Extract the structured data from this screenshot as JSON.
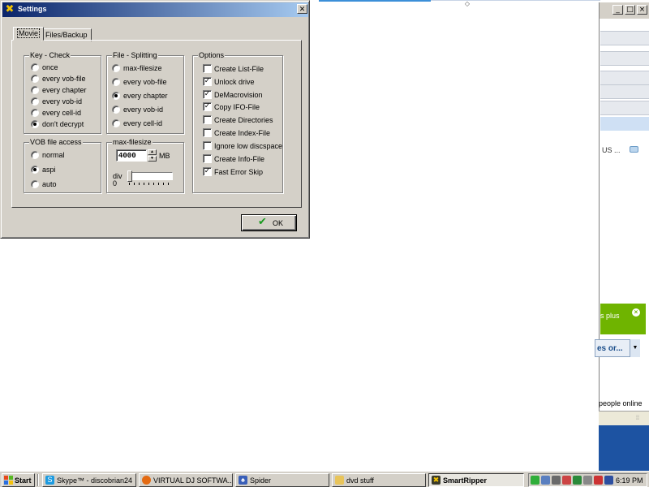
{
  "dialog": {
    "title": "Settings",
    "close_glyph": "✕",
    "tabs": [
      {
        "label": "Movie",
        "active": true
      },
      {
        "label": "Files/Backup",
        "active": false
      }
    ],
    "key_check": {
      "title": "Key - Check",
      "options": [
        "once",
        "every vob-file",
        "every chapter",
        "every vob-id",
        "every cell-id",
        "don't decrypt"
      ],
      "selected": "don't decrypt"
    },
    "file_splitting": {
      "title": "File - Splitting",
      "options": [
        "max-filesize",
        "every vob-file",
        "every chapter",
        "every vob-id",
        "every cell-id"
      ],
      "selected": "every chapter"
    },
    "vob_access": {
      "title": "VOB file access",
      "options": [
        "normal",
        "aspi",
        "auto"
      ],
      "selected": "aspi"
    },
    "max_filesize": {
      "title": "max-filesize",
      "value": "4000",
      "unit": "MB",
      "div_label": "div",
      "div_value": "0"
    },
    "options": {
      "title": "Options",
      "items": [
        {
          "label": "Create List-File",
          "checked": false
        },
        {
          "label": "Unlock drive",
          "checked": true
        },
        {
          "label": "DeMacrovision",
          "checked": true
        },
        {
          "label": "Copy IFO-File",
          "checked": true
        },
        {
          "label": "Create Directories",
          "checked": false
        },
        {
          "label": "Create Index-File",
          "checked": false
        },
        {
          "label": "Ignore low discspace",
          "checked": false
        },
        {
          "label": "Create Info-File",
          "checked": false
        },
        {
          "label": "Fast Error Skip",
          "checked": true
        }
      ]
    },
    "ok_label": "OK"
  },
  "background_window": {
    "country_text": "US ...",
    "promo_text": "s plus",
    "dropdown_text": "es or...",
    "online_text": "people online"
  },
  "taskbar": {
    "start_label": "Start",
    "tasks": [
      {
        "label": "Skype™ - discobrian24",
        "icon": "skype-icon",
        "active": false
      },
      {
        "label": "VIRTUAL DJ SOFTWA...",
        "icon": "firefox-icon",
        "active": false
      },
      {
        "label": "Spider",
        "icon": "spider-icon",
        "active": false
      },
      {
        "label": "dvd stuff",
        "icon": "folder-icon",
        "active": false
      },
      {
        "label": "SmartRipper",
        "icon": "smartripper-icon",
        "active": true
      }
    ],
    "clock": "6:19 PM"
  }
}
